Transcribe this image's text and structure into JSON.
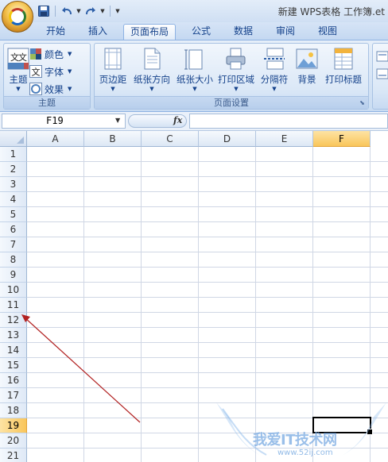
{
  "window": {
    "title": "新建 WPS表格 工作簿.et"
  },
  "tabs": [
    {
      "label": "开始"
    },
    {
      "label": "插入"
    },
    {
      "label": "页面布局",
      "active": true
    },
    {
      "label": "公式"
    },
    {
      "label": "数据"
    },
    {
      "label": "审阅"
    },
    {
      "label": "视图"
    }
  ],
  "ribbon": {
    "theme_group": {
      "label": "主题",
      "theme_button": "主题",
      "colors": "颜色",
      "fonts": "字体",
      "effects": "效果",
      "theme_icon_text": "文文"
    },
    "page_setup_group": {
      "label": "页面设置",
      "margins": "页边距",
      "orientation": "纸张方向",
      "size": "纸张大小",
      "print_area": "打印区域",
      "breaks": "分隔符",
      "background": "背景",
      "print_titles": "打印标题"
    }
  },
  "formula_bar": {
    "name_box": "F19",
    "fx_label": "fx",
    "formula": ""
  },
  "sheet": {
    "columns": [
      "A",
      "B",
      "C",
      "D",
      "E",
      "F"
    ],
    "selected_column": "F",
    "rows": [
      "1",
      "2",
      "3",
      "4",
      "5",
      "6",
      "7",
      "8",
      "9",
      "10",
      "11",
      "12",
      "13",
      "14",
      "15",
      "16",
      "17",
      "18",
      "19",
      "20",
      "21"
    ],
    "selected_row": "19",
    "active_cell": "F19"
  },
  "watermark": {
    "text": "我爱IT技术网",
    "url": "www.52ij.com"
  },
  "colors": {
    "accent": "#15428b",
    "selected_header": "#f9c65b",
    "arrow": "#b22222"
  }
}
